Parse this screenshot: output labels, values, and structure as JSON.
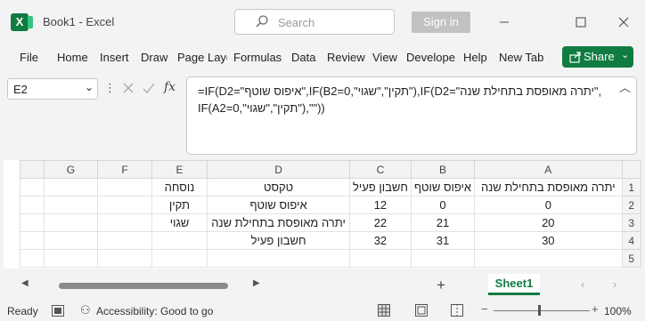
{
  "window": {
    "title": "Book1  -  Excel",
    "app_logo": "X"
  },
  "search": {
    "placeholder": "Search"
  },
  "account": {
    "signin_label": "Sign in"
  },
  "ribbon": {
    "tabs": [
      "File",
      "Home",
      "Insert",
      "Draw",
      "Page Layo",
      "Formulas",
      "Data",
      "Review",
      "View",
      "Develope",
      "Help",
      "New Tab"
    ],
    "share_label": "Share"
  },
  "formula_bar": {
    "name_box": "E2",
    "line1": "=IF(D2=\"איפוס שוטף\",IF(B2=0,\"תקין\",\"שגוי\"),IF(D2=\"יתרה מאופסת בתחילת שנה\",",
    "line2": "IF(A2=0,\"תקין\",\"שגוי\"),\"\"))",
    "fx": "fx"
  },
  "grid": {
    "columns": [
      "G",
      "F",
      "E",
      "D",
      "C",
      "B",
      "A"
    ],
    "rows": [
      {
        "num": "1",
        "cells": [
          "",
          "",
          "נוסחה",
          "טקסט",
          "חשבון פעיל",
          "איפוס שוטף",
          "יתרה מאופסת בתחילת שנה"
        ]
      },
      {
        "num": "2",
        "cells": [
          "",
          "",
          "תקין",
          "איפוס שוטף",
          "12",
          "0",
          "0"
        ]
      },
      {
        "num": "3",
        "cells": [
          "",
          "",
          "שגוי",
          "יתרה מאופסת בתחילת שנה",
          "22",
          "21",
          "20"
        ]
      },
      {
        "num": "4",
        "cells": [
          "",
          "",
          "",
          "חשבון פעיל",
          "32",
          "31",
          "30"
        ]
      },
      {
        "num": "5",
        "cells": [
          "",
          "",
          "",
          "",
          "",
          "",
          ""
        ]
      }
    ]
  },
  "sheets": {
    "active": "Sheet1",
    "add": "+"
  },
  "status": {
    "ready": "Ready",
    "accessibility": "Accessibility: Good to go",
    "zoom": "100%"
  }
}
